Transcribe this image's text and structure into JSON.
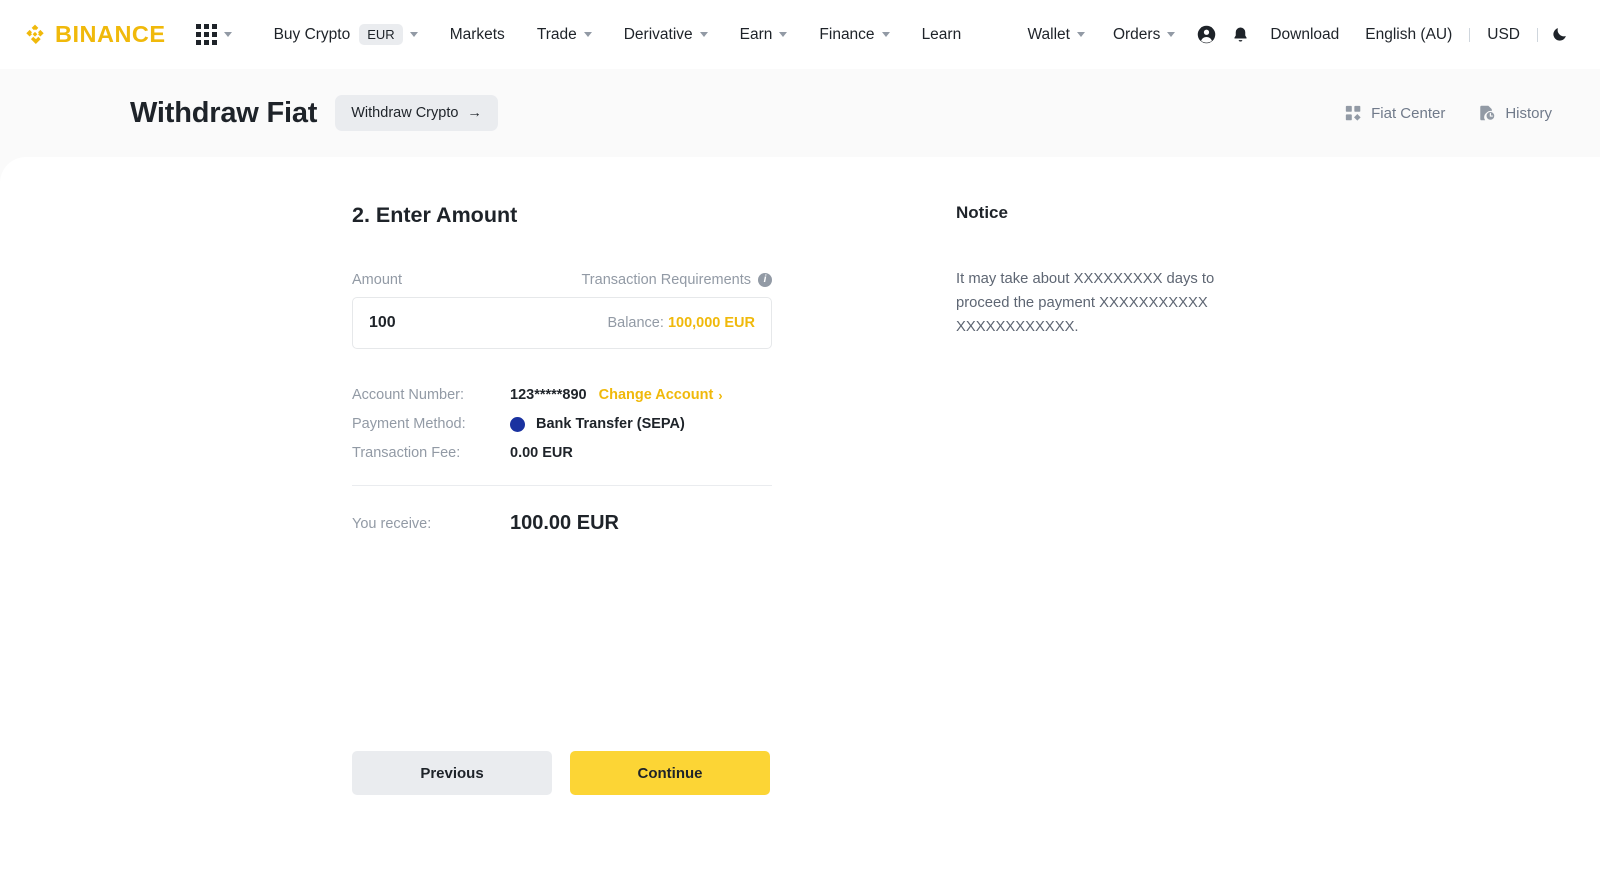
{
  "brand": {
    "name": "BINANCE",
    "color": "#F0B90B"
  },
  "topnav": {
    "apps_icon": "apps-grid-icon",
    "items": [
      {
        "label": "Buy Crypto",
        "pill": "EUR",
        "caret": true
      },
      {
        "label": "Markets",
        "caret": false
      },
      {
        "label": "Trade",
        "caret": true
      },
      {
        "label": "Derivative",
        "caret": true
      },
      {
        "label": "Earn",
        "caret": true
      },
      {
        "label": "Finance",
        "caret": true
      },
      {
        "label": "Learn",
        "caret": false
      }
    ],
    "right": {
      "wallet": "Wallet",
      "orders": "Orders",
      "profile_icon": "user-circle-icon",
      "notification_icon": "bell-icon",
      "download": "Download",
      "language": "English (AU)",
      "currency": "USD",
      "theme_icon": "moon-icon"
    }
  },
  "header": {
    "title": "Withdraw Fiat",
    "switch_button": "Withdraw Crypto",
    "switch_arrow": "→",
    "fiat_center": "Fiat Center",
    "history": "History"
  },
  "main": {
    "step_title": "2. Enter Amount",
    "amount_label": "Amount",
    "requirements_label": "Transaction Requirements",
    "amount_value": "100",
    "balance_prefix": "Balance: ",
    "balance_value": "100,000 EUR",
    "rows": [
      {
        "key": "Account Number:",
        "value": "123*****890"
      },
      {
        "key": "Payment Method:",
        "value": "Bank Transfer (SEPA)"
      },
      {
        "key": "Transaction Fee:",
        "value": "0.00 EUR"
      }
    ],
    "change_account": "Change Account",
    "change_account_chevron": "›",
    "receive_label": "You receive:",
    "receive_value": "100.00 EUR"
  },
  "notice": {
    "title": "Notice",
    "text": "It may take about XXXXXXXXX days to proceed the payment XXXXXXXXXXX XXXXXXXXXXXX."
  },
  "actions": {
    "previous": "Previous",
    "continue": "Continue"
  }
}
